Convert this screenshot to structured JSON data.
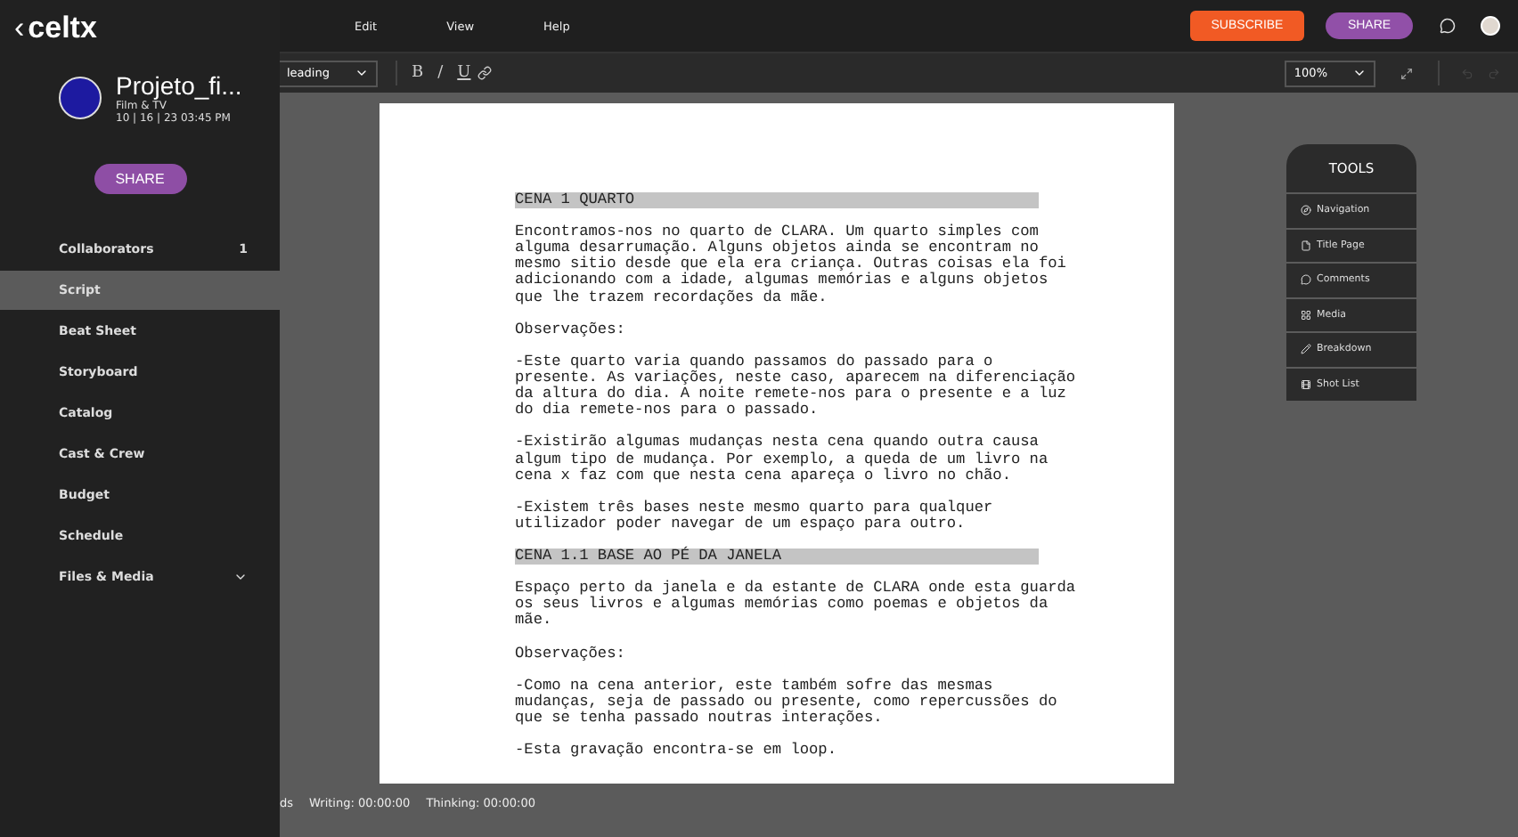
{
  "app": {
    "back": "‹",
    "logo": "celtx"
  },
  "menu": [
    "Edit",
    "View",
    "Help"
  ],
  "topbar": {
    "subscribe": "SUBSCRIBE",
    "share": "SHARE"
  },
  "project": {
    "title": "Projeto_fi...",
    "type": "Film & TV",
    "date": "10 | 16 | 23 03:45 PM",
    "share": "SHARE"
  },
  "sidebar": {
    "items": [
      {
        "label": "Collaborators",
        "count": "1",
        "selected": false
      },
      {
        "label": "Script",
        "selected": true
      },
      {
        "label": "Beat Sheet",
        "selected": false
      },
      {
        "label": "Storyboard",
        "selected": false
      },
      {
        "label": "Catalog",
        "selected": false
      },
      {
        "label": "Cast & Crew",
        "selected": false
      },
      {
        "label": "Budget",
        "selected": false
      },
      {
        "label": "Schedule",
        "selected": false
      },
      {
        "label": "Files & Media",
        "expandable": true,
        "selected": false
      }
    ]
  },
  "toolbar": {
    "element_type": "leading",
    "format": [
      "B",
      "/",
      "U"
    ],
    "zoom": "100%"
  },
  "script": [
    {
      "kind": "heading",
      "lines": [
        "CENA 1 QUARTO"
      ]
    },
    {
      "kind": "action",
      "lines": [
        "Encontramos-nos no quarto de CLARA. Um quarto simples com",
        "alguma desarrumação. Alguns objetos ainda se encontram no",
        "mesmo sitio desde que ela era criança. Outras coisas ela foi",
        "adicionando com a idade, algumas memórias e alguns objetos",
        "que lhe trazem recordações da mãe."
      ]
    },
    {
      "kind": "action",
      "lines": [
        "Observações:"
      ]
    },
    {
      "kind": "action",
      "lines": [
        "-Este quarto varia quando passamos do passado para o",
        "presente. As variações, neste caso, aparecem na diferenciação",
        "da altura do dia. A noite remete-nos para o presente e a luz",
        "do dia remete-nos para o passado."
      ]
    },
    {
      "kind": "action",
      "lines": [
        "-Existirão algumas mudanças nesta cena quando outra causa",
        "algum tipo de mudança. Por exemplo, a queda de um livro na",
        "cena x faz com que nesta cena apareça o livro no chão."
      ]
    },
    {
      "kind": "action",
      "lines": [
        "-Existem três bases neste mesmo quarto para qualquer",
        "utilizador poder navegar de um espaço para outro."
      ]
    },
    {
      "kind": "heading",
      "lines": [
        "CENA 1.1 BASE AO PÉ DA JANELA"
      ]
    },
    {
      "kind": "action",
      "lines": [
        "Espaço perto da janela e da estante de CLARA onde esta guarda",
        "os seus livros e algumas memórias como poemas e objetos da",
        "mãe."
      ]
    },
    {
      "kind": "action",
      "lines": [
        "Observações:"
      ]
    },
    {
      "kind": "action",
      "lines": [
        "-Como na cena anterior, este também sofre das mesmas",
        "mudanças, seja de passado ou presente, como repercussões do",
        "que se tenha passado noutras interações."
      ]
    },
    {
      "kind": "action",
      "lines": [
        "-Esta gravação encontra-se em loop."
      ]
    }
  ],
  "tools": {
    "title": "TOOLS",
    "items": [
      {
        "kind": "navigation",
        "label": "Navigation"
      },
      {
        "kind": "title_page",
        "label": "Title Page"
      },
      {
        "kind": "comments",
        "label": "Comments"
      },
      {
        "kind": "media",
        "label": "Media"
      },
      {
        "kind": "breakdown",
        "label": "Breakdown"
      },
      {
        "kind": "shot_list",
        "label": "Shot List"
      }
    ]
  },
  "status_bar": {
    "cut": "ds",
    "writing": "Writing: 00:00:00",
    "thinking": "Thinking: 00:00:00"
  }
}
